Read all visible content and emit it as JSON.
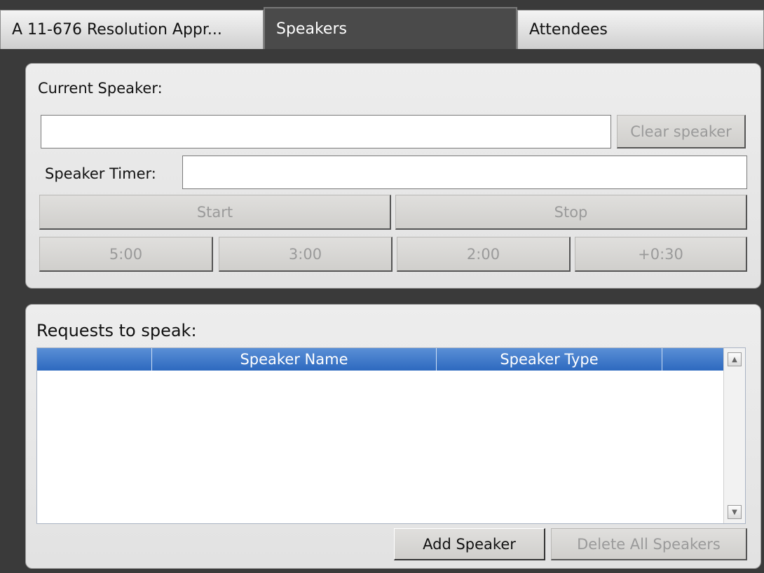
{
  "tabs": [
    {
      "label": "A 11-676 Resolution Appr..."
    },
    {
      "label": "Speakers"
    },
    {
      "label": "Attendees"
    }
  ],
  "current_speaker": {
    "label": "Current Speaker:",
    "value": "",
    "clear_button": "Clear speaker"
  },
  "timer": {
    "label": "Speaker Timer:",
    "value": "",
    "start_button": "Start",
    "stop_button": "Stop",
    "presets": [
      "5:00",
      "3:00",
      "2:00",
      "+0:30"
    ]
  },
  "requests": {
    "label": "Requests to speak:",
    "columns": [
      "",
      "Speaker Name",
      "Speaker Type",
      ""
    ],
    "rows": []
  },
  "actions": {
    "add_speaker": "Add Speaker",
    "delete_all": "Delete All Speakers"
  },
  "icons": {
    "scroll_up": "scroll-up-arrow",
    "scroll_down": "scroll-down-arrow"
  }
}
